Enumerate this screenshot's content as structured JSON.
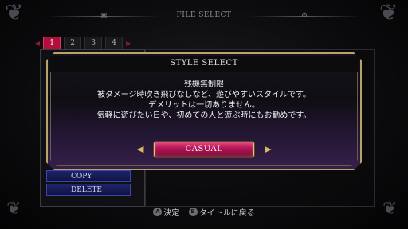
{
  "background": {
    "screen_title": "FILE SELECT",
    "left_icon": "file-icon",
    "right_icon": "gear-icon",
    "page_tabs": [
      "1",
      "2",
      "3",
      "4"
    ],
    "active_tab": "1",
    "side_buttons": {
      "copy_label": "COPY",
      "delete_label": "DELETE"
    },
    "accent_color": "#b10f3c"
  },
  "modal": {
    "title": "STYLE SELECT",
    "description": [
      "残機無制限",
      "被ダメージ時吹き飛びなしなど、遊びやすいスタイルです。",
      "デメリットは一切ありません。",
      "気軽に遊びたい日や、初めての人と遊ぶ時にもお勧めです。"
    ],
    "selected_style": "CASUAL",
    "left_arrow_icon": "arrow-left-icon",
    "right_arrow_icon": "arrow-right-icon",
    "frame_color": "#b8a46a",
    "button_color": "#b01553"
  },
  "footer": {
    "confirm_button_glyph": "A",
    "confirm_label": "決定",
    "back_button_glyph": "B",
    "back_label": "タイトルに戻る"
  }
}
